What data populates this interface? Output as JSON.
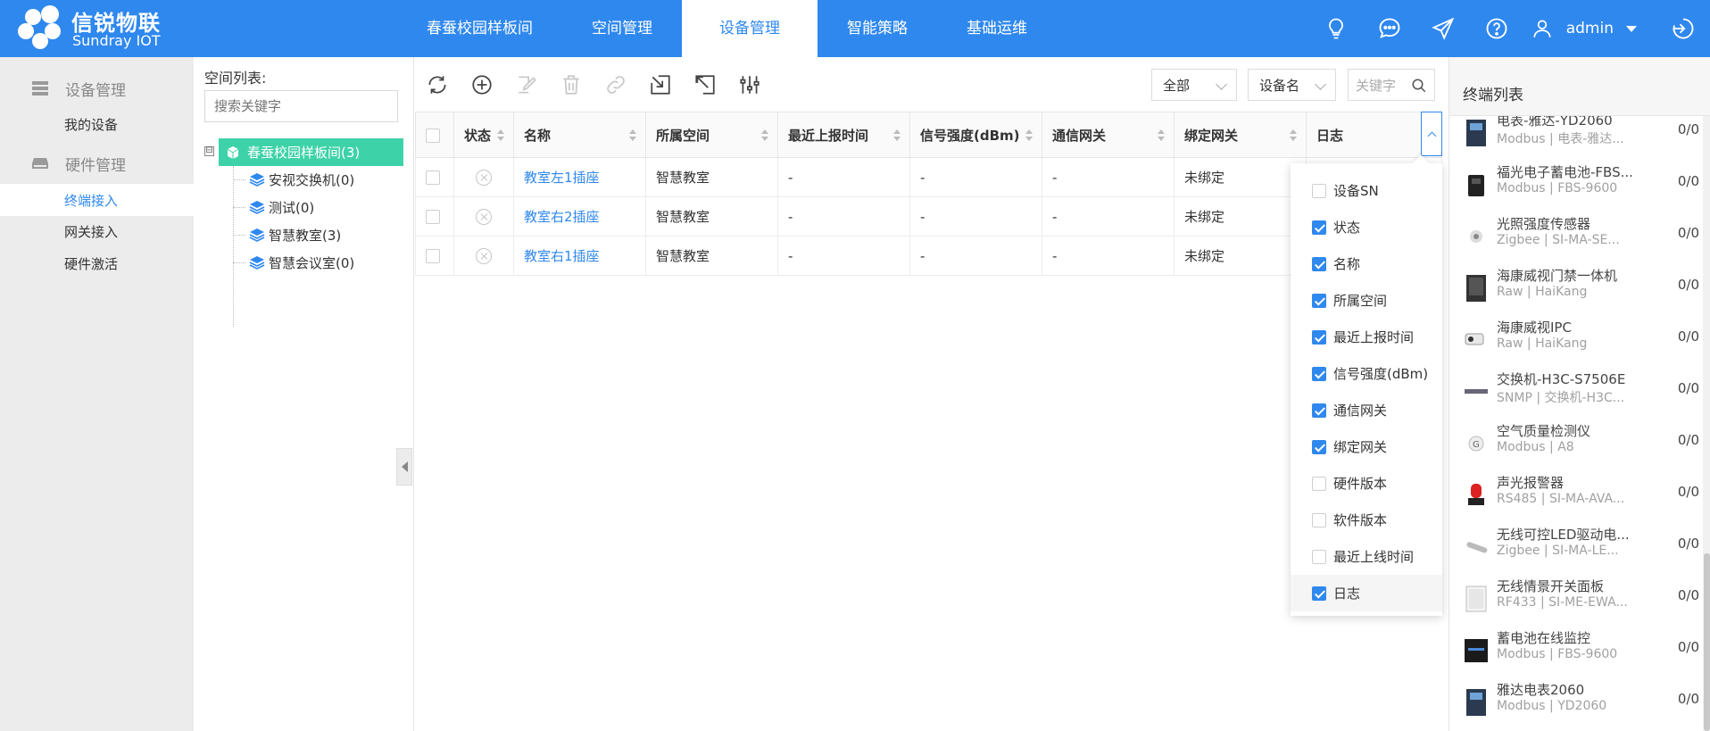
{
  "brand": {
    "name_cn": "信锐物联",
    "name_en": "Sundray IOT"
  },
  "nav": {
    "items": [
      "春蚕校园样板间",
      "空间管理",
      "设备管理",
      "智能策略",
      "基础运维"
    ],
    "active": 2
  },
  "header": {
    "username": "admin",
    "icons": [
      "bulb-icon",
      "chat-icon",
      "send-icon",
      "help-icon",
      "user-icon",
      "logout-icon"
    ]
  },
  "sidebar": {
    "group1": "设备管理",
    "group1_items": [
      "我的设备"
    ],
    "group2": "硬件管理",
    "group2_items": [
      "终端接入",
      "网关接入",
      "硬件激活"
    ],
    "active_item": "终端接入"
  },
  "space": {
    "title": "空间列表:",
    "search_placeholder": "搜索关键字",
    "root": "春蚕校园样板间(3)",
    "toggle": "⊟",
    "children": [
      "安视交换机(0)",
      "测试(0)",
      "智慧教室(3)",
      "智慧会议室(0)"
    ]
  },
  "filters": {
    "scope": "全部",
    "field": "设备名",
    "keyword_placeholder": "关键字"
  },
  "table": {
    "headers": [
      "状态",
      "名称",
      "所属空间",
      "最近上报时间",
      "信号强度(dBm)",
      "通信网关",
      "绑定网关",
      "日志"
    ],
    "rows": [
      {
        "name": "教室左1插座",
        "space": "智慧教室",
        "last_report": "-",
        "signal": "-",
        "comm_gateway": "-",
        "bind_gateway": "未绑定"
      },
      {
        "name": "教室右2插座",
        "space": "智慧教室",
        "last_report": "-",
        "signal": "-",
        "comm_gateway": "-",
        "bind_gateway": "未绑定"
      },
      {
        "name": "教室右1插座",
        "space": "智慧教室",
        "last_report": "-",
        "signal": "-",
        "comm_gateway": "-",
        "bind_gateway": "未绑定"
      }
    ]
  },
  "column_menu": {
    "items": [
      {
        "label": "设备SN",
        "checked": false
      },
      {
        "label": "状态",
        "checked": true
      },
      {
        "label": "名称",
        "checked": true
      },
      {
        "label": "所属空间",
        "checked": true
      },
      {
        "label": "最近上报时间",
        "checked": true
      },
      {
        "label": "信号强度(dBm)",
        "checked": true
      },
      {
        "label": "通信网关",
        "checked": true
      },
      {
        "label": "绑定网关",
        "checked": true
      },
      {
        "label": "硬件版本",
        "checked": false
      },
      {
        "label": "软件版本",
        "checked": false
      },
      {
        "label": "最近上线时间",
        "checked": false
      },
      {
        "label": "日志",
        "checked": true
      }
    ]
  },
  "terminals": {
    "title": "终端列表",
    "items": [
      {
        "name": "电表-雅达-YD2060",
        "sub": "Modbus | 电表-雅达...",
        "count": "0/0"
      },
      {
        "name": "福光电子蓄电池-FBS...",
        "sub": "Modbus | FBS-9600",
        "count": "0/0"
      },
      {
        "name": "光照强度传感器",
        "sub": "Zigbee | SI-MA-SE...",
        "count": "0/0"
      },
      {
        "name": "海康威视门禁一体机",
        "sub": "Raw | HaiKang",
        "count": "0/0"
      },
      {
        "name": "海康威视IPC",
        "sub": "Raw | HaiKang",
        "count": "0/0"
      },
      {
        "name": "交换机-H3C-S7506E",
        "sub": "SNMP | 交换机-H3C...",
        "count": "0/0"
      },
      {
        "name": "空气质量检测仪",
        "sub": "Modbus | A8",
        "count": "0/0"
      },
      {
        "name": "声光报警器",
        "sub": "RS485 | SI-MA-AVA...",
        "count": "0/0"
      },
      {
        "name": "无线可控LED驱动电...",
        "sub": "Zigbee | SI-MA-LE...",
        "count": "0/0"
      },
      {
        "name": "无线情景开关面板",
        "sub": "RF433 | SI-ME-EWA...",
        "count": "0/0"
      },
      {
        "name": "蓄电池在线监控",
        "sub": "Modbus | FBS-9600",
        "count": "0/0"
      },
      {
        "name": "雅达电表2060",
        "sub": "Modbus | YD2060",
        "count": "0/0"
      }
    ]
  },
  "colors": {
    "primary": "#2f88ee",
    "tree_active": "#3ed2a9",
    "sidebar_bg": "#ececec"
  }
}
